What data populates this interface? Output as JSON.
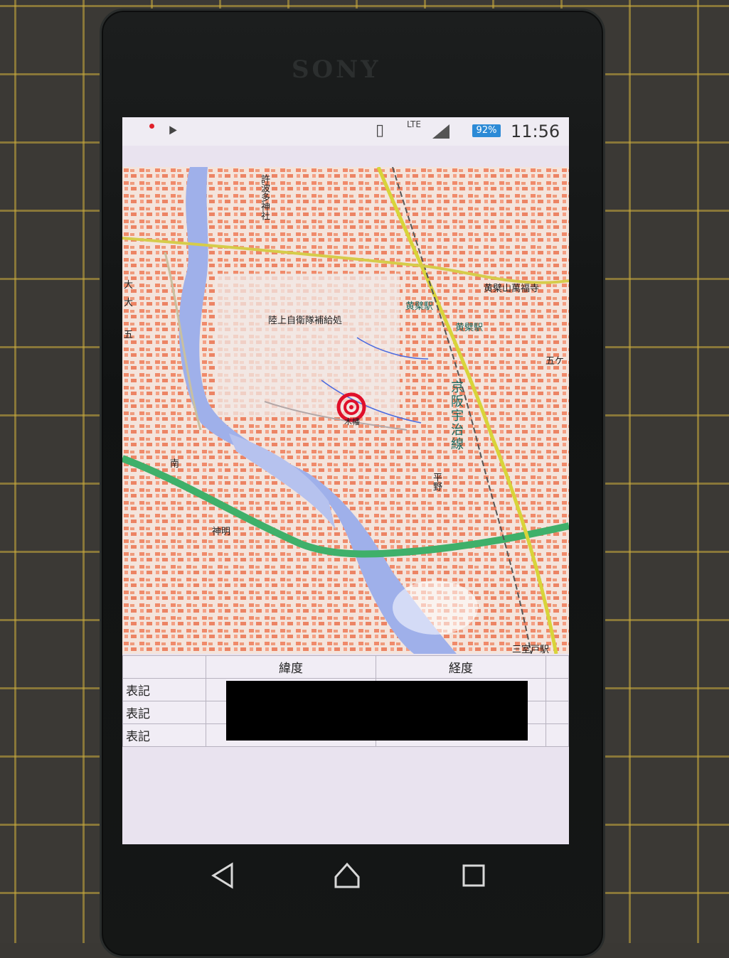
{
  "device": {
    "brand": "SONY"
  },
  "status_bar": {
    "lte": "LTE",
    "battery": "92%",
    "time": "11:56"
  },
  "map": {
    "labels": {
      "shrine": "許波多神社",
      "jgsdf": "陸上自衛隊補給処",
      "obaku_station": "黄檗駅",
      "obaku_station_2": "黄檗駅",
      "manpukuji": "黄檗山萬福寺",
      "keihan_line": "京阪宇治線",
      "gokasho": "五ケ",
      "mimurodo": "三室戸駅",
      "minami": "南",
      "shinmei": "神明",
      "hirano": "平野",
      "marker_label": "木幡",
      "left_cut_1": "大",
      "left_cut_2": "大",
      "left_cut_3": "五"
    }
  },
  "coord_table": {
    "headers": [
      "",
      "緯度",
      "経度",
      ""
    ],
    "rows": [
      {
        "label": "表記"
      },
      {
        "label": "表記"
      },
      {
        "label": "表記"
      }
    ]
  },
  "nav": {
    "back_icon": "back-triangle-icon",
    "home_icon": "home-icon",
    "recents_icon": "recents-square-icon"
  },
  "colors": {
    "marker": "#e0102a",
    "expressway": "#3fb06a",
    "river": "#9fb0ea",
    "railway": "#d8d43a"
  }
}
